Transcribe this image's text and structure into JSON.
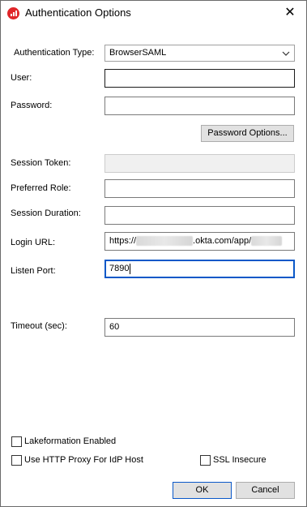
{
  "window": {
    "title": "Authentication Options",
    "close_glyph": "✕",
    "app_icon": "app-logo-icon"
  },
  "fields": {
    "auth_type": {
      "label": "Authentication Type:",
      "value": "BrowserSAML"
    },
    "user": {
      "label": "User:",
      "value": ""
    },
    "password": {
      "label": "Password:",
      "value": ""
    },
    "password_options_button": "Password Options...",
    "session_token": {
      "label": "Session Token:",
      "value": ""
    },
    "preferred_role": {
      "label": "Preferred Role:",
      "value": ""
    },
    "session_duration": {
      "label": "Session Duration:",
      "value": ""
    },
    "login_url": {
      "label": "Login URL:",
      "prefix": "https://",
      "middle": ".okta.com/app/"
    },
    "listen_port": {
      "label": "Listen Port:",
      "value": "7890"
    },
    "timeout": {
      "label": "Timeout (sec):",
      "value": "60"
    }
  },
  "checkboxes": {
    "lakeformation": {
      "label": "Lakeformation Enabled",
      "checked": false
    },
    "http_proxy": {
      "label": "Use HTTP Proxy For IdP Host",
      "checked": false
    },
    "ssl_insecure": {
      "label": "SSL Insecure",
      "checked": false
    }
  },
  "buttons": {
    "ok": "OK",
    "cancel": "Cancel"
  },
  "colors": {
    "focus_border": "#0a58c8",
    "icon_red": "#e0262a"
  }
}
